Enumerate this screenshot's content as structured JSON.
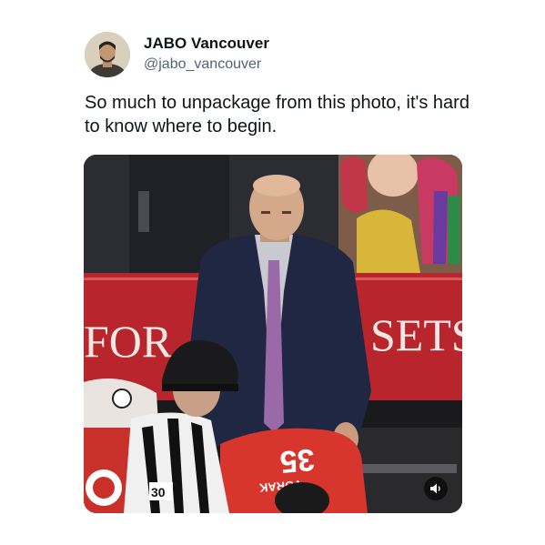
{
  "author": {
    "display_name": "JABO Vancouver",
    "handle": "@jabo_vancouver"
  },
  "tweet": {
    "text": "So much to unpackage from this photo, it's hard to know where to begin."
  },
  "media": {
    "banner_left": "FOR",
    "banner_right": "SETS",
    "jersey_number": "30",
    "jersey_name": "VORAK",
    "jersey_number_big": "35",
    "icon": "speaker-icon"
  },
  "colors": {
    "text": "#0f1419",
    "secondary": "#536471",
    "banner_red": "#b8252c",
    "suit": "#1f2742",
    "tie": "#9a6aa8"
  }
}
